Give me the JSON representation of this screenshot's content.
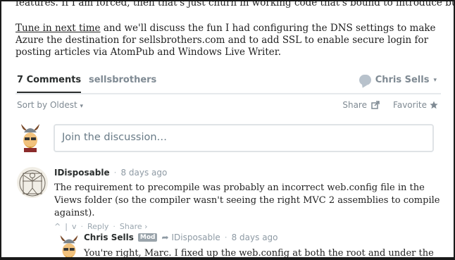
{
  "article": {
    "cut_line": "features. If I am forced, then that's just churn in working code that's bound to introduce bugs.",
    "link_text": "Tune in next time",
    "para_rest": " and we'll discuss the fun I had configuring the DNS settings to make Azure the destination for sellsbrothers.com and to add SSL to enable secure login for posting articles via AtomPub and Windows Live Writer."
  },
  "tabs": {
    "comments_label": "7 Comments",
    "site_label": "sellsbrothers",
    "user_label": "Chris Sells",
    "user_caret": "▾"
  },
  "sortbar": {
    "sort_label": "Sort by Oldest",
    "sort_caret": "▾",
    "share_label": "Share",
    "favorite_label": "Favorite"
  },
  "join": {
    "placeholder": "Join the discussion…"
  },
  "comments": [
    {
      "author": "IDisposable",
      "time": "8 days ago",
      "text": "The requirement to precompile was probably an incorrect web.config file in the Views folder (so the compiler wasn't seeing the right MVC 2 assemblies to compile against).",
      "vote_up": "^",
      "vote_sep": "|",
      "vote_down": "v",
      "reply": "Reply",
      "share": "Share ›"
    },
    {
      "author": "Chris Sells",
      "badge": "Mod",
      "reply_to": "IDisposable",
      "time": "8 days ago",
      "text": "You're right, Marc. I fixed up the web.config at both the root and under the Views"
    }
  ],
  "colors": {
    "accent": "#2a2e2e",
    "muted": "#7f8a93",
    "border": "#dfe3e6"
  }
}
